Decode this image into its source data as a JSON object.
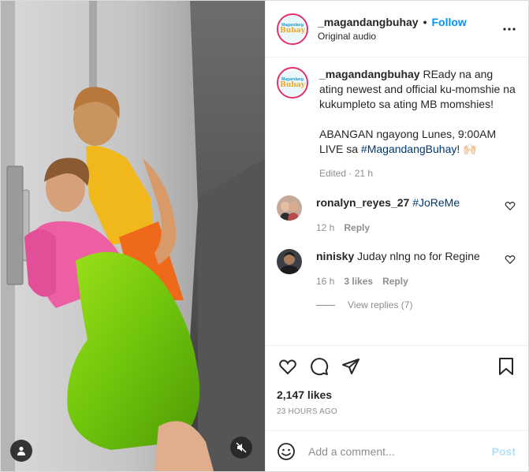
{
  "post": {
    "username": "_magandangbuhay",
    "follow_label": "Follow",
    "audio": "Original audio",
    "logo_line1": "Magandang",
    "logo_line2": "Buhay"
  },
  "caption": {
    "username": "_magandangbuhay",
    "text1": " REady na ang ating newest and official ku-momshie na kukumpleto sa ating MB momshies!",
    "text2": "ABANGAN ngayong Lunes, 9:00AM LIVE sa ",
    "hashtag": "#MagandangBuhay",
    "text2_end": "! 🙌🏻",
    "meta": "Edited · 21 h"
  },
  "comments": [
    {
      "username": "ronalyn_reyes_27",
      "hashtag": "#JoReMe",
      "text": "",
      "time": "12 h",
      "likes": "",
      "reply": "Reply"
    },
    {
      "username": "ninisky",
      "hashtag": "",
      "text": "Juday nlng no for Regine",
      "time": "16 h",
      "likes": "3 likes",
      "reply": "Reply"
    }
  ],
  "view_replies": "View replies (7)",
  "likes": "2,147 likes",
  "time": "23 HOURS AGO",
  "add_comment": {
    "placeholder": "Add a comment...",
    "post_label": "Post"
  },
  "colors": {
    "accent": "#0095f6",
    "post_disabled": "#b2dffc",
    "muted": "#8e8e8e"
  }
}
